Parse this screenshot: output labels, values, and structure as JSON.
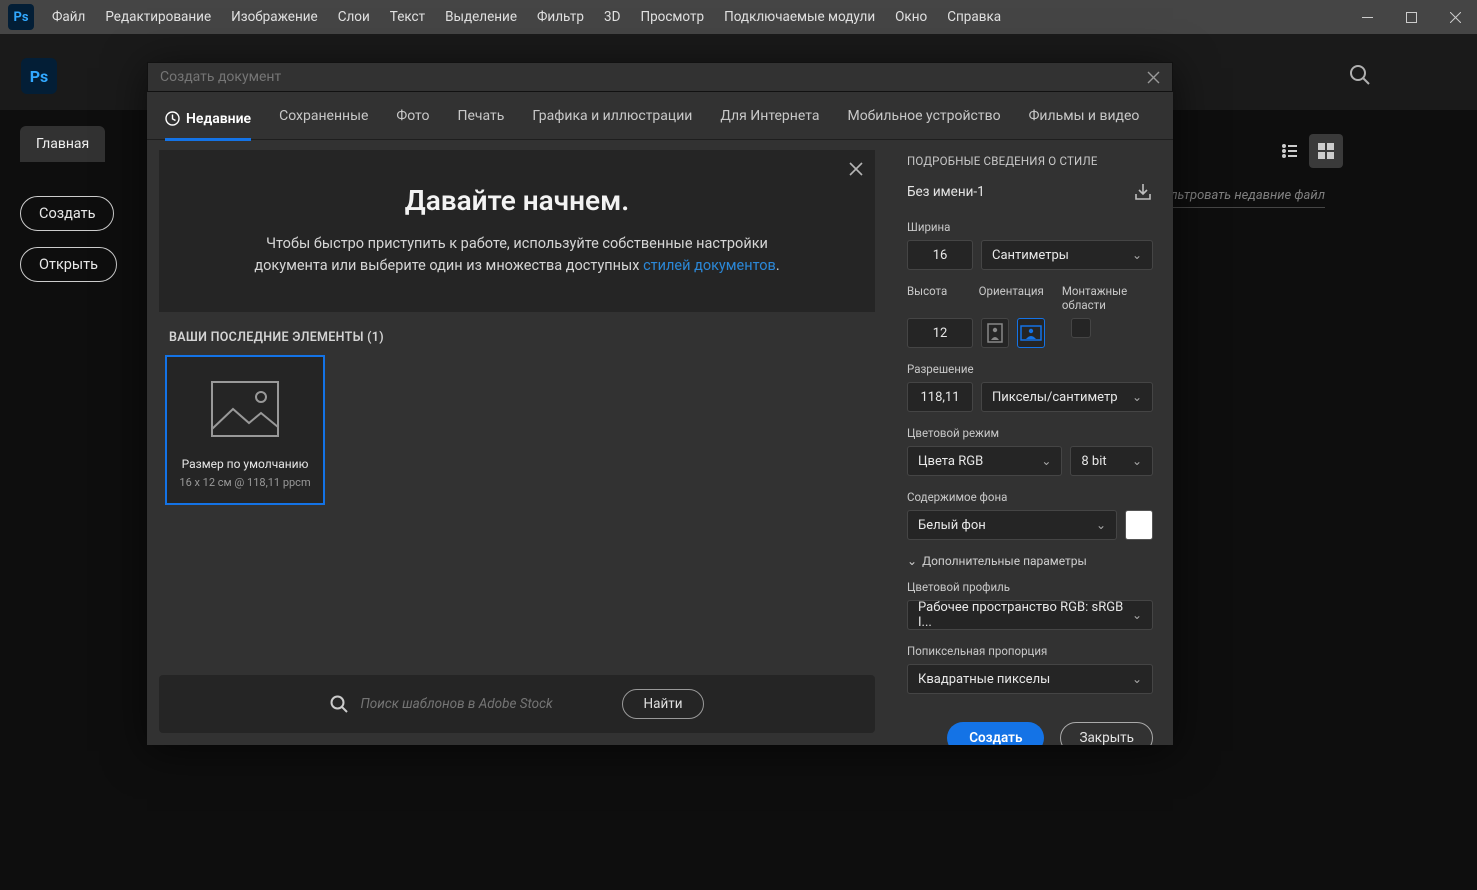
{
  "app": {
    "logo": "Ps"
  },
  "menubar": [
    "Файл",
    "Редактирование",
    "Изображение",
    "Слои",
    "Текст",
    "Выделение",
    "Фильтр",
    "3D",
    "Просмотр",
    "Подключаемые модули",
    "Окно",
    "Справка"
  ],
  "home": {
    "tab": "Главная",
    "create": "Создать",
    "open": "Открыть",
    "filterHint": "льтровать недавние файл"
  },
  "dialog": {
    "searchPlaceholder": "Создать документ",
    "tabs": [
      "Недавние",
      "Сохраненные",
      "Фото",
      "Печать",
      "Графика и иллюстрации",
      "Для Интернета",
      "Мобильное устройство",
      "Фильмы и видео"
    ],
    "hero": {
      "title": "Давайте начнем.",
      "p1": "Чтобы быстро приступить к работе, используйте собственные настройки",
      "p2a": "документа или выберите один из множества доступных ",
      "linkText": "стилей документов",
      "p2b": "."
    },
    "recentLabel": "ВАШИ ПОСЛЕДНИЕ ЭЛЕМЕНТЫ  (1)",
    "card": {
      "title": "Размер по умолчанию",
      "meta": "16 x 12 см @ 118,11 ppcm"
    },
    "stock": {
      "placeholder": "Поиск шаблонов в Adobe Stock",
      "go": "Найти"
    }
  },
  "panel": {
    "title": "ПОДРОБНЫЕ СВЕДЕНИЯ О СТИЛЕ",
    "name": "Без имени-1",
    "width": {
      "label": "Ширина",
      "value": "16",
      "unit": "Сантиметры"
    },
    "height": {
      "label": "Высота",
      "value": "12"
    },
    "orientation": "Ориентация",
    "artboards": "Монтажные области",
    "resolution": {
      "label": "Разрешение",
      "value": "118,11",
      "unit": "Пикселы/сантиметр"
    },
    "colorMode": {
      "label": "Цветовой режим",
      "value": "Цвета RGB",
      "depth": "8 bit"
    },
    "bg": {
      "label": "Содержимое фона",
      "value": "Белый фон"
    },
    "advanced": "Дополнительные параметры",
    "profile": {
      "label": "Цветовой профиль",
      "value": "Рабочее пространство RGB: sRGB I..."
    },
    "pixelAspect": {
      "label": "Попиксельная пропорция",
      "value": "Квадратные пикселы"
    },
    "createBtn": "Создать",
    "closeBtn": "Закрыть"
  }
}
